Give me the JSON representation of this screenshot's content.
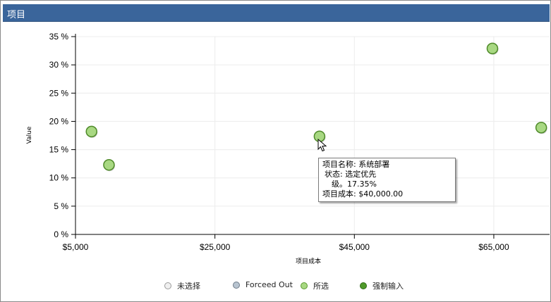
{
  "window": {
    "title": "项目"
  },
  "chart_data": {
    "type": "scatter",
    "xlabel": "项目成本",
    "ylabel": "Value",
    "xlim": [
      5000,
      73000
    ],
    "ylim": [
      0,
      35
    ],
    "x_ticks": [
      {
        "value": 5000,
        "label": "$5,000"
      },
      {
        "value": 25000,
        "label": "$25,000"
      },
      {
        "value": 45000,
        "label": "$45,000"
      },
      {
        "value": 65000,
        "label": "$65,000"
      }
    ],
    "y_ticks": [
      {
        "value": 0,
        "label": "0 %"
      },
      {
        "value": 5,
        "label": "5 %"
      },
      {
        "value": 10,
        "label": "10 %"
      },
      {
        "value": 15,
        "label": "15 %"
      },
      {
        "value": 20,
        "label": "20 %"
      },
      {
        "value": 25,
        "label": "25 %"
      },
      {
        "value": 30,
        "label": "30 %"
      },
      {
        "value": 35,
        "label": "35 %"
      }
    ],
    "grid": true,
    "points": [
      {
        "x": 7300,
        "y": 18.2
      },
      {
        "x": 9800,
        "y": 12.3
      },
      {
        "x": 40000,
        "y": 17.35
      },
      {
        "x": 64800,
        "y": 32.9
      },
      {
        "x": 71800,
        "y": 18.9
      }
    ],
    "point_color": "#a8d882",
    "point_edge_color": "#4f8a2a"
  },
  "tooltip": {
    "line1": "项目名称: 系统部署",
    "line2": "状态: 选定优先",
    "line3": "级。17.35%",
    "line4": "项目成本: $40,000.00"
  },
  "legend": {
    "position": "bottom",
    "items": [
      {
        "label": "未选择",
        "color": "#f0f0f0",
        "edge": "#9a9a9a"
      },
      {
        "label": "Forceed Out",
        "color": "#b8c4d0",
        "edge": "#6d7a88"
      },
      {
        "label": "所选",
        "color": "#a8d882",
        "edge": "#5a9a30"
      },
      {
        "label": "强制输入",
        "color": "#4f9a2a",
        "edge": "#2f6a18"
      }
    ]
  }
}
